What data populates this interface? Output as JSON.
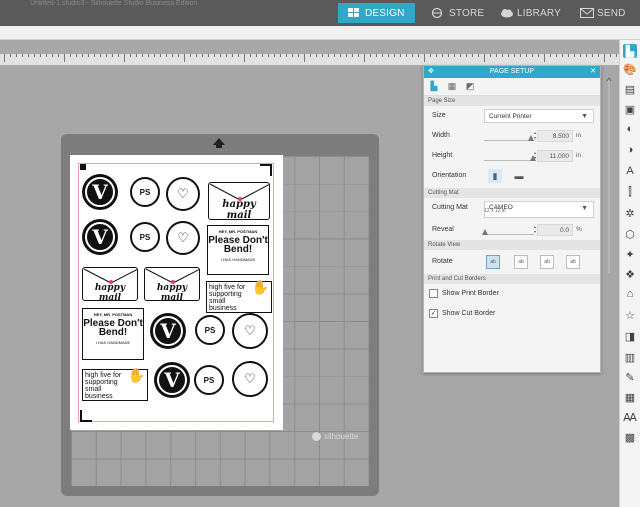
{
  "topbar": {
    "doc_title": "Untitled-1.studio3 - Silhouette Studio Business Edition",
    "tabs": [
      {
        "label": "DESIGN",
        "icon": "grid-icon",
        "active": true
      },
      {
        "label": "STORE",
        "icon": "globe-icon",
        "active": false
      },
      {
        "label": "LIBRARY",
        "icon": "cloud-icon",
        "active": false
      },
      {
        "label": "SEND",
        "icon": "send-icon",
        "active": false
      }
    ]
  },
  "colors": {
    "accent": "#2fa9c9",
    "cut_line": "#e8a3a3",
    "heart_pink": "#e7357a"
  },
  "canvas": {
    "brand": "silhouette",
    "stickers": {
      "monogram": "V",
      "ps": "PS",
      "happy_mail": "happy mail",
      "postman_top": "HEY, MR. POSTMAN",
      "postman_main": "Please Don't Bend!",
      "postman_bottom": "I HAS HANDMADE",
      "high_five": "high five for supporting small business"
    }
  },
  "panel": {
    "title": "PAGE SETUP",
    "sections": {
      "page_size": "Page Size",
      "cutting_mat": "Cutting Mat",
      "rotate_view": "Rotate View",
      "borders": "Print and Cut Borders"
    },
    "size_label": "Size",
    "size_value": "Current Printer",
    "width_label": "Width",
    "width_value": "8.500",
    "height_label": "Height",
    "height_value": "11.000",
    "unit_in": "in",
    "orientation_label": "Orientation",
    "cutting_mat_label": "Cutting Mat",
    "cutting_mat_value": "CAMEO",
    "cutting_mat_sub": "12 x 12 in",
    "reveal_label": "Reveal",
    "reveal_value": "0.0",
    "unit_pct": "%",
    "rotate_label": "Rotate",
    "rotate_options": [
      "ab",
      "ab",
      "ab",
      "ab"
    ],
    "show_print_border": "Show Print Border",
    "show_cut_border": "Show Cut Border",
    "print_border_checked": false,
    "cut_border_checked": true
  }
}
